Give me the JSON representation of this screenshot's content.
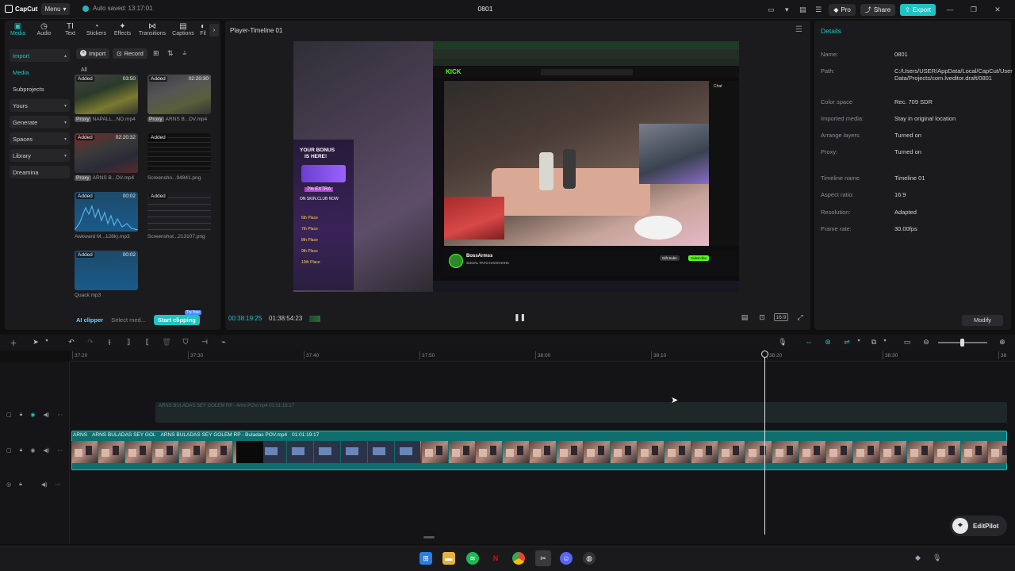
{
  "app": {
    "logo_text": "CapCut",
    "menu_label": "Menu",
    "autosave": "Auto saved: 13:17:01",
    "project_title": "0801",
    "pro_label": "Pro",
    "share_label": "Share",
    "export_label": "Export",
    "accent": "#1fc3c3"
  },
  "media_tabs": [
    "Media",
    "Audio",
    "Text",
    "Stickers",
    "Effects",
    "Transitions",
    "Captions",
    "Fil"
  ],
  "media_nav": [
    {
      "label": "Import",
      "type": "section"
    },
    {
      "label": "Media",
      "type": "active"
    },
    {
      "label": "Subprojects",
      "type": "plain"
    },
    {
      "label": "Yours",
      "type": "section"
    },
    {
      "label": "Generate",
      "type": "section"
    },
    {
      "label": "Spaces",
      "type": "section"
    },
    {
      "label": "Library",
      "type": "section"
    },
    {
      "label": "Dreamina",
      "type": "section"
    }
  ],
  "media_toolbar": {
    "import_label": "Import",
    "record_label": "Record",
    "all_label": "All"
  },
  "media_items": [
    {
      "added": "Added",
      "duration": "03:50",
      "proxy": "Proxy",
      "name": "NAPALL...NO.mp4"
    },
    {
      "added": "Added",
      "duration": "02:20:30",
      "proxy": "Proxy",
      "name": "ARNS B...DV.mp4"
    },
    {
      "added": "Added",
      "duration": "02:20:32",
      "proxy": "Proxy",
      "name": "ARNS B...DV.mp4"
    },
    {
      "added": "Added",
      "duration": "",
      "proxy": "",
      "name": "Screensho...94841.png"
    },
    {
      "added": "Added",
      "duration": "00:02",
      "proxy": "",
      "name": "Awkward M...128k).mp3"
    },
    {
      "added": "Added",
      "duration": "",
      "proxy": "",
      "name": "Screenshot...213107.png"
    },
    {
      "added": "Added",
      "duration": "00:02",
      "proxy": "",
      "name": "Quack.mp3"
    }
  ],
  "ai_bar": {
    "ai_clipper": "AI clipper",
    "select_media": "Select med...",
    "start_clipping": "Start clipping",
    "badge": "Try free"
  },
  "player": {
    "title": "Player-Timeline 01",
    "current_time": "00:38:19:25",
    "total_time": "01:38:54:23",
    "ratio_label": "16:9"
  },
  "details": {
    "title": "Details",
    "rows": [
      {
        "k": "Name:",
        "v": "0801"
      },
      {
        "k": "Path:",
        "v": "C:/Users/USER/AppData/Local/CapCut/User Data/Projects/com.lveditor.draft/0801"
      },
      {
        "k": "Color space",
        "v": "Rec. 709 SDR"
      },
      {
        "k": "Imported media:",
        "v": "Stay in original location"
      },
      {
        "k": "Arrange layers",
        "v": "Turned on"
      },
      {
        "k": "Proxy:",
        "v": "Turned on"
      },
      {
        "k": "Timeline name",
        "v": "Timeline 01"
      },
      {
        "k": "Aspect ratio:",
        "v": "16:9"
      },
      {
        "k": "Resolution:",
        "v": "Adapted"
      },
      {
        "k": "Frame rate:",
        "v": "30.00fps"
      }
    ],
    "modify_label": "Modify"
  },
  "video_overlay": {
    "site_logo": "KICK",
    "streamer": "BossArmss",
    "subtitle": "SUGAL TAYO HAHAHAHA",
    "bonus_lines": [
      "YOUR BONUS",
      "IS HERE!"
    ],
    "bonus_extra": "7% EXTRA",
    "bonus_site": "ON SKIN.CLUB NOW",
    "places": [
      "6th Place",
      "7th Place",
      "8th Place",
      "9th Place",
      "10th Place"
    ],
    "chat_label": "Chat",
    "gift_label": "Gift Subs",
    "subscribe_label": "Subscribe"
  },
  "timeline": {
    "ruler": [
      "37:20",
      "37:30",
      "37:40",
      "37:50",
      "38:00",
      "38:10",
      "38:20",
      "38:30",
      "38"
    ],
    "ghost_clip": "ARNS BULADAS SEY GOLEM RP - Arns POV.mp4   01:01:19:17",
    "main_clip_prefix": [
      "ARNS",
      "ARNS BULADAS SEY GOL"
    ],
    "main_clip_label": "ARNS BULADAS SEY GOLEM RP - Buladas  POV.mp4",
    "main_clip_duration": "01:01:19:17"
  },
  "editpilot_label": "EditPilot"
}
